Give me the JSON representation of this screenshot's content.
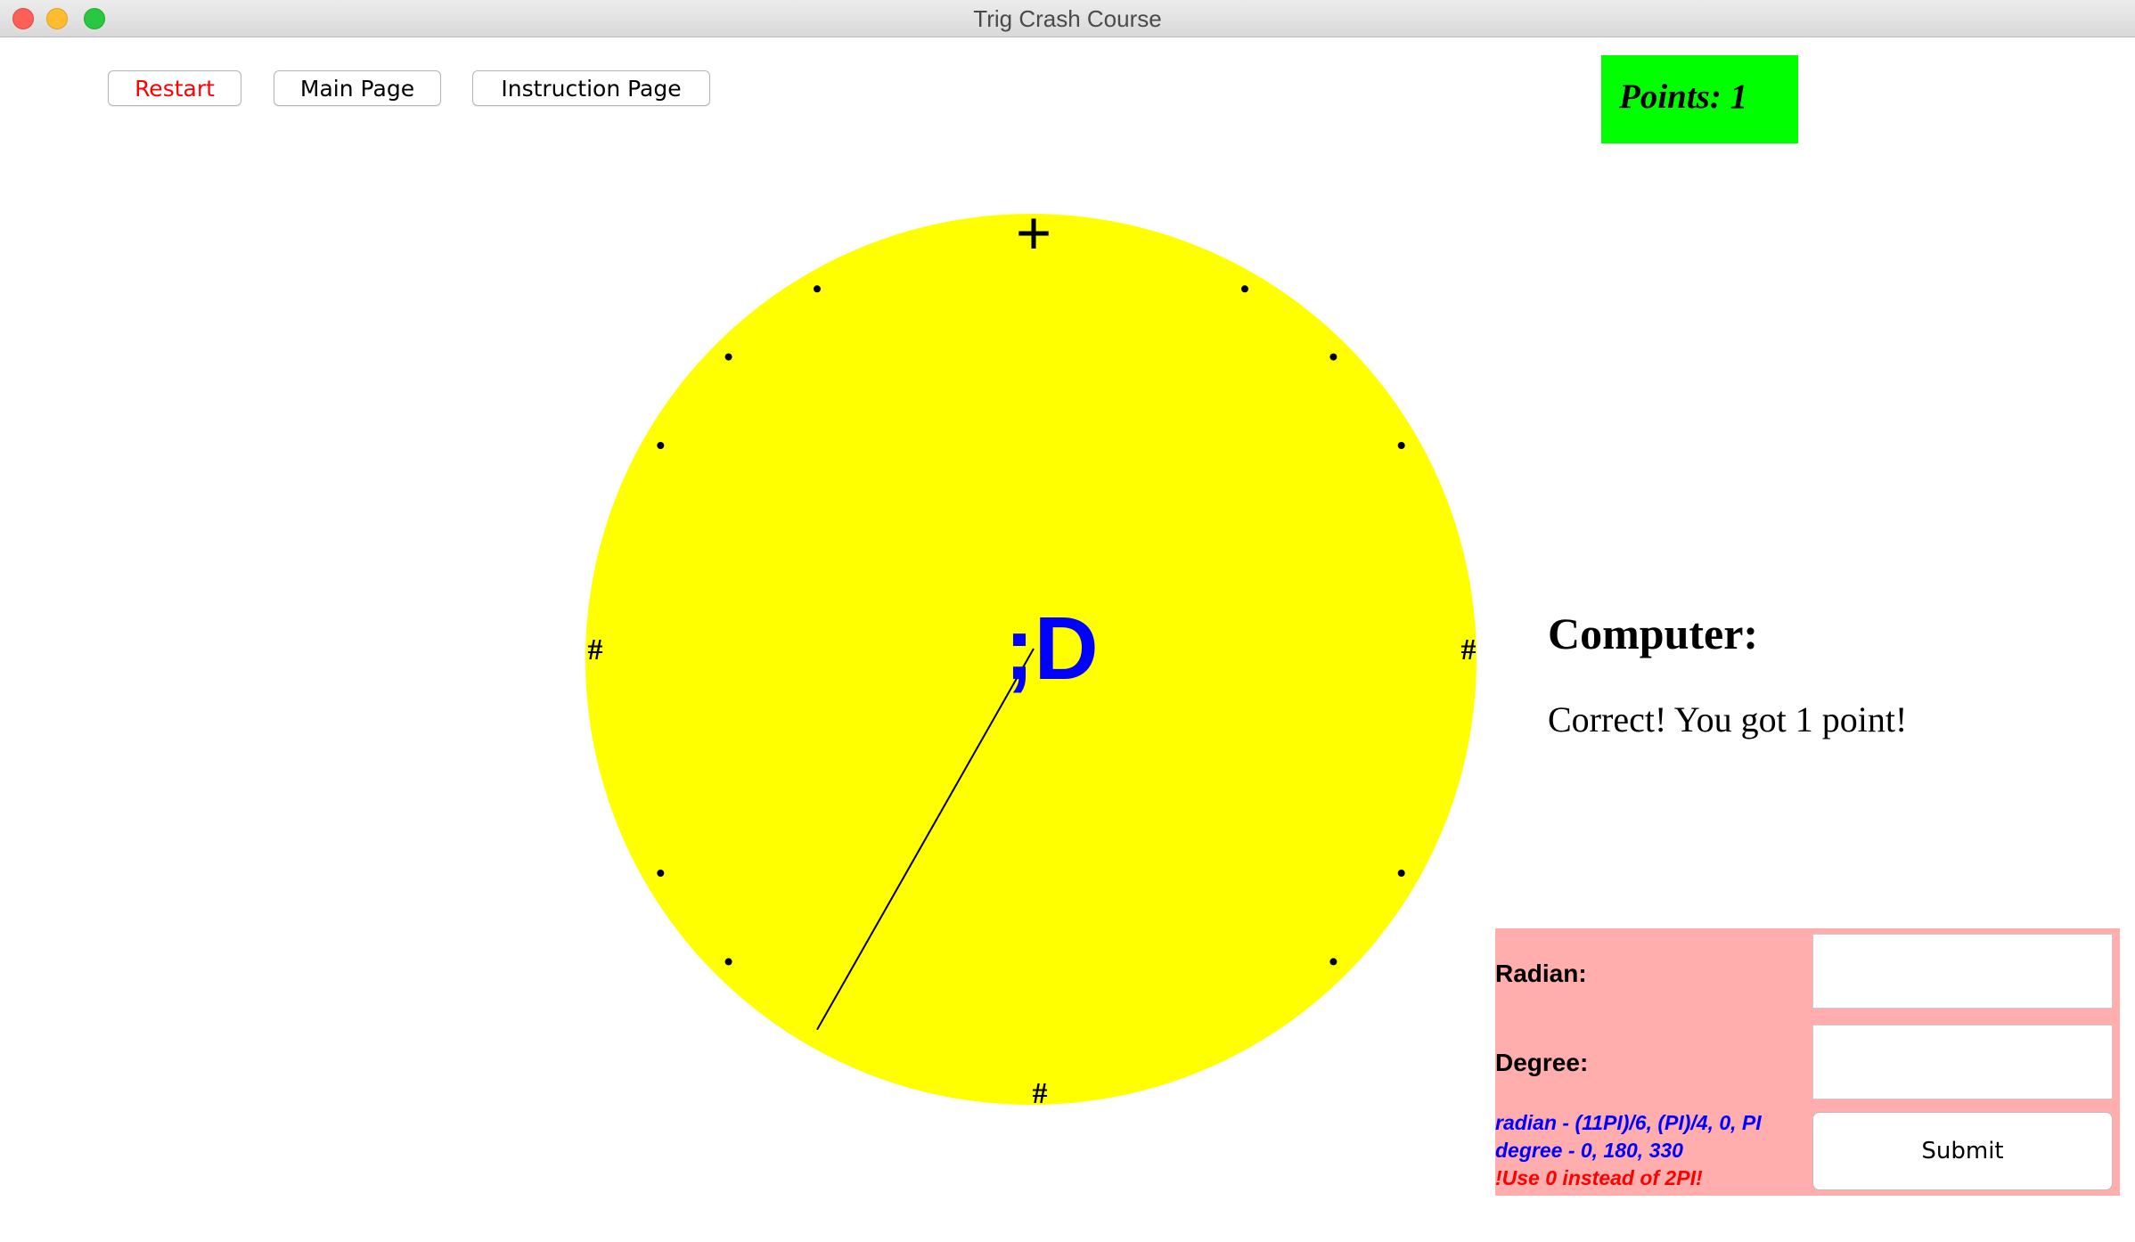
{
  "window": {
    "title": "Trig Crash Course"
  },
  "toolbar": {
    "restart_label": "Restart",
    "main_label": "Main Page",
    "instruction_label": "Instruction Page"
  },
  "score": {
    "text": "Points: 1"
  },
  "unit_circle": {
    "fill_color": "#ffff00",
    "face_text": ";D",
    "face_color": "#0000ff",
    "cardinal_marks": {
      "top": "+",
      "left": "#",
      "right": "#",
      "bottom": "#"
    },
    "pointer_angle_degrees": 240,
    "dot_angles_degrees": [
      30,
      45,
      60,
      120,
      135,
      150,
      210,
      225,
      315,
      330
    ]
  },
  "computer": {
    "label": "Computer:",
    "message": "Correct! You got 1 point!"
  },
  "answer_panel": {
    "background": "#ffadad",
    "radian_label": "Radian:",
    "radian_value": "",
    "degree_label": "Degree:",
    "degree_value": "",
    "submit_label": "Submit",
    "hint_radian": "radian - (11PI)/6, (PI)/4, 0, PI",
    "hint_degree": "degree - 0, 180, 330",
    "hint_warning": "!Use 0 instead of 2PI!"
  }
}
